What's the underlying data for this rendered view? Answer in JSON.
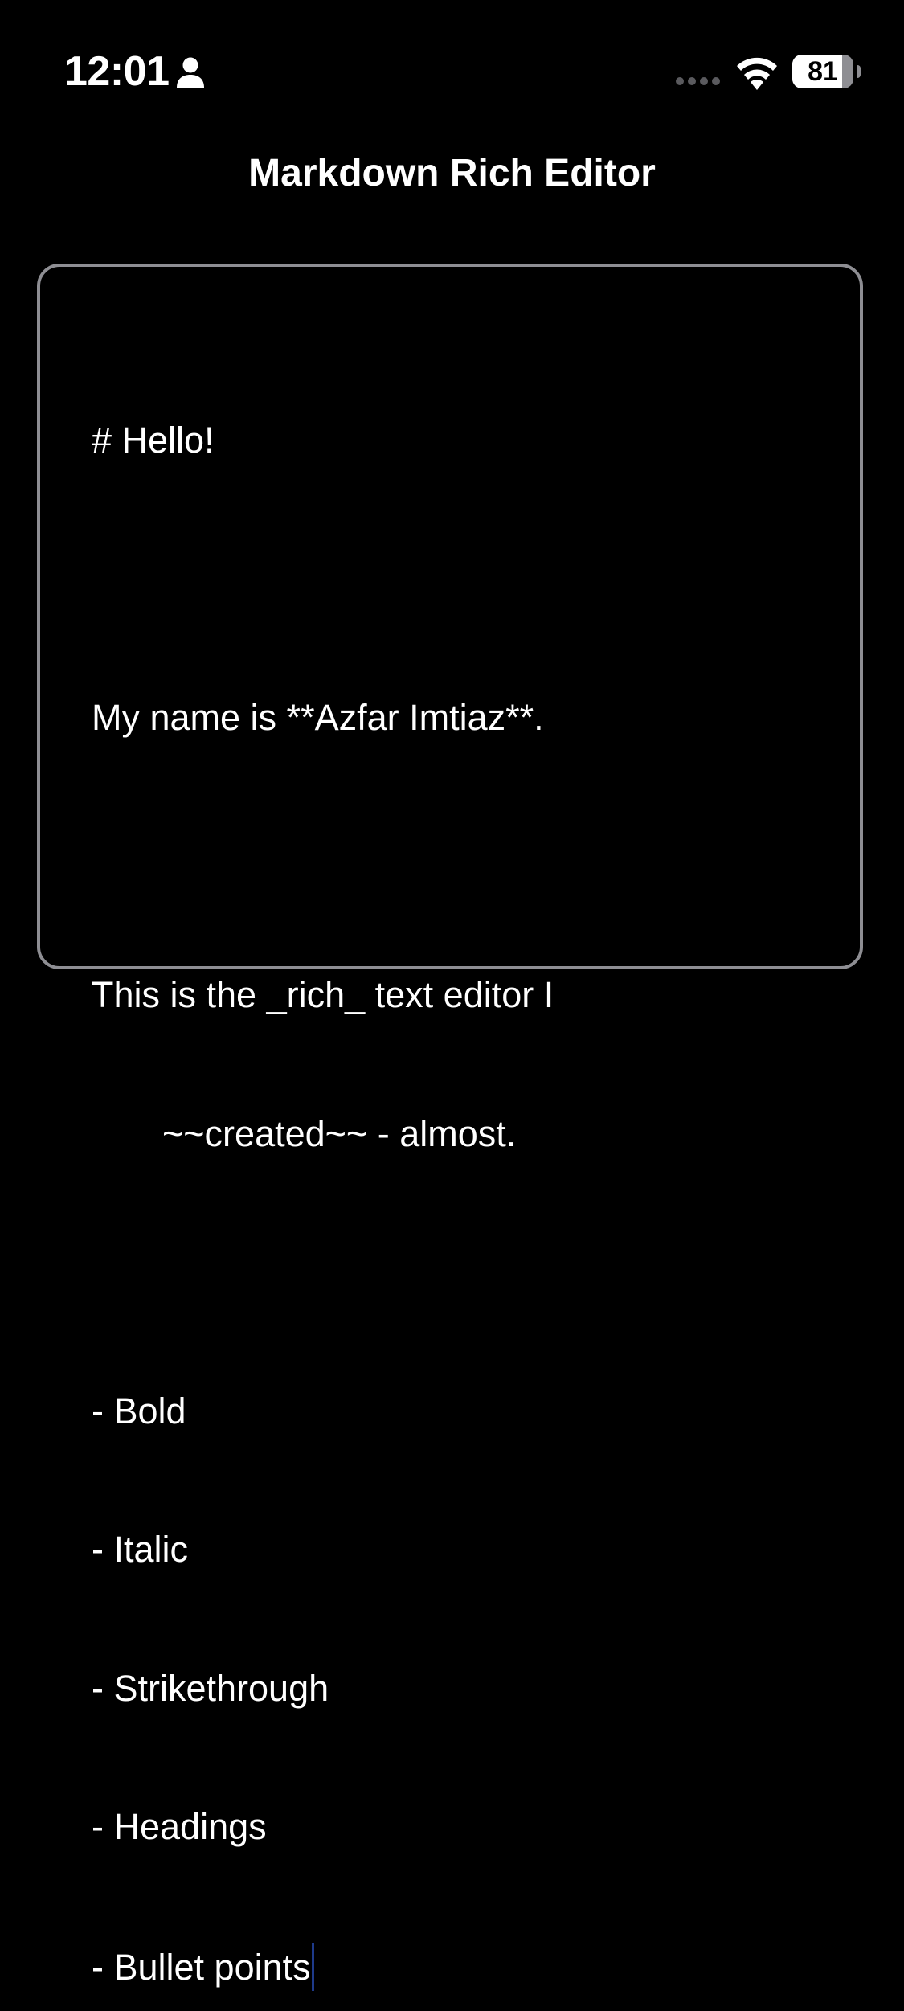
{
  "status_bar": {
    "time": "12:01",
    "battery_level": "81",
    "battery_fraction": 0.81,
    "icons": [
      "person-icon",
      "cellular-dots-icon",
      "wifi-icon",
      "battery-icon"
    ]
  },
  "header": {
    "title": "Markdown Rich Editor"
  },
  "editor": {
    "lines": [
      "# Hello!",
      "",
      "My name is **Azfar Imtiaz**.",
      "",
      "This is the _rich_ text editor I",
      "~~created~~ - almost.",
      "",
      "- Bold",
      "- Italic",
      "- Strikethrough",
      "- Headings",
      "- Bullet points"
    ],
    "caret_color": "#1e3a8a"
  },
  "colors": {
    "background": "#000000",
    "text": "#ffffff",
    "border": "#8e8e93"
  }
}
